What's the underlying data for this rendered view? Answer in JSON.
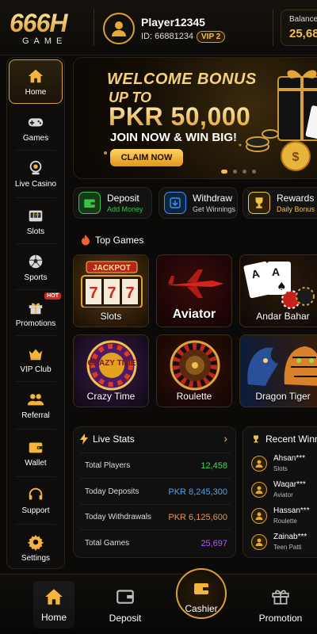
{
  "brand": {
    "logo_main": "666H",
    "logo_sub": "GAME"
  },
  "user": {
    "name": "Player12345",
    "id_text": "ID: 66881234",
    "vip": "VIP 2"
  },
  "balance": {
    "label": "Balance",
    "value": "25,68"
  },
  "sidebar": {
    "items": [
      {
        "label": "Home",
        "icon": "home-icon",
        "active": true
      },
      {
        "label": "Games",
        "icon": "gamepad-icon"
      },
      {
        "label": "Live Casino",
        "icon": "live-casino-icon"
      },
      {
        "label": "Slots",
        "icon": "slot-machine-icon"
      },
      {
        "label": "Sports",
        "icon": "football-icon"
      },
      {
        "label": "Promotions",
        "icon": "gift-icon",
        "badge": "HOT"
      },
      {
        "label": "VIP Club",
        "icon": "crown-icon"
      },
      {
        "label": "Referral",
        "icon": "users-icon"
      },
      {
        "label": "Wallet",
        "icon": "wallet-icon"
      },
      {
        "label": "Support",
        "icon": "headset-icon"
      },
      {
        "label": "Settings",
        "icon": "gear-icon"
      }
    ]
  },
  "banner": {
    "line1": "WELCOME BONUS",
    "line2": "UP TO",
    "amount": "PKR 50,000",
    "line4": "JOIN NOW & WIN BIG!",
    "cta": "CLAIM NOW"
  },
  "quick_actions": [
    {
      "title": "Deposit",
      "subtitle": "Add Money",
      "icon": "wallet-icon",
      "color": "#39c24a"
    },
    {
      "title": "Withdraw",
      "subtitle": "Get Winnings",
      "icon": "withdraw-icon",
      "color": "#3c8ef0"
    },
    {
      "title": "Rewards",
      "subtitle": "Daily Bonus",
      "icon": "trophy-icon",
      "color": "#f3c14b"
    }
  ],
  "top_games": {
    "title": "Top Games",
    "games": [
      {
        "name": "Slots",
        "art_text": "JACKPOT"
      },
      {
        "name": "Aviator"
      },
      {
        "name": "Andar Bahar"
      },
      {
        "name": "Crazy Time",
        "art_text": "CRAZY TIME"
      },
      {
        "name": "Roulette"
      },
      {
        "name": "Dragon Tiger"
      }
    ]
  },
  "live_stats": {
    "title": "Live Stats",
    "rows": [
      {
        "label": "Total Players",
        "value": "12,458",
        "color": "#4fd15b"
      },
      {
        "label": "Today Deposits",
        "value": "PKR 8,245,300",
        "color": "#4aa7f2"
      },
      {
        "label": "Today Withdrawals",
        "value": "PKR 6,125,600",
        "color": "#f2913a"
      },
      {
        "label": "Total Games",
        "value": "25,697",
        "color": "#b658f2"
      }
    ]
  },
  "recent_winners": {
    "title": "Recent Winn",
    "items": [
      {
        "name": "Ahsan***",
        "game": "Slots"
      },
      {
        "name": "Waqar***",
        "game": "Aviator"
      },
      {
        "name": "Hassan***",
        "game": "Roulette"
      },
      {
        "name": "Zainab***",
        "game": "Teen Patti"
      }
    ]
  },
  "bottom_nav": {
    "home": "Home",
    "deposit": "Deposit",
    "cashier": "Cashier",
    "promotion": "Promotion"
  }
}
